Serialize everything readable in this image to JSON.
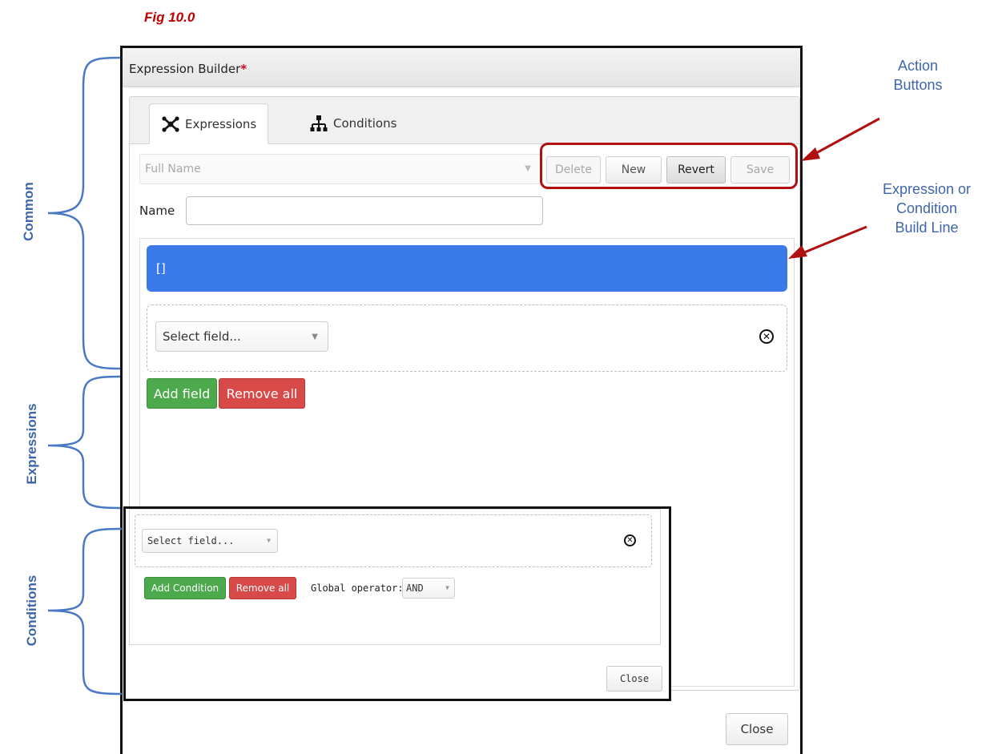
{
  "figure": {
    "caption": "Fig 10.0"
  },
  "dialog": {
    "title": "Expression Builder",
    "required_marker": "*",
    "tabs": [
      {
        "label": "Expressions",
        "icon": "expressions-icon",
        "active": true
      },
      {
        "label": "Conditions",
        "icon": "conditions-icon",
        "active": false
      }
    ],
    "expression_select": {
      "value": "Full Name"
    },
    "actions": {
      "delete": "Delete",
      "new": "New",
      "revert": "Revert",
      "save": "Save"
    },
    "name": {
      "label": "Name",
      "value": ""
    },
    "build_line": {
      "text": "[]",
      "color": "#3a7ae8"
    },
    "field": {
      "placeholder": "Select field..."
    },
    "add_field": "Add field",
    "remove_all": "Remove all",
    "close": "Close"
  },
  "conditions_panel": {
    "field_placeholder": "Select field...",
    "add_condition": "Add Condition",
    "remove_all": "Remove all",
    "global_operator_label": "Global operator:",
    "global_operator_value": "AND",
    "close": "Close"
  },
  "annotations": {
    "common": "Common",
    "expressions": "Expressions",
    "conditions": "Conditions",
    "action_buttons_line1": "Action",
    "action_buttons_line2": "Buttons",
    "build_line_1": "Expression or",
    "build_line_2": "Condition",
    "build_line_3": "Build Line",
    "annotation_color": "#3f66a8",
    "arrow_color": "#b01010"
  }
}
